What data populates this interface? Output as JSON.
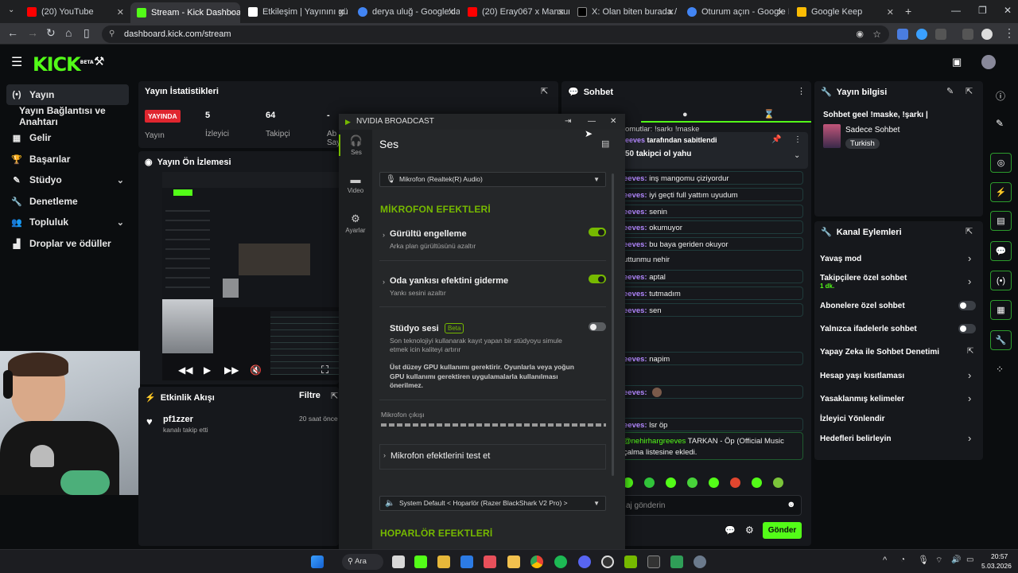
{
  "browser": {
    "tabs": [
      {
        "title": "(20) YouTube",
        "color": "#ff0000"
      },
      {
        "title": "Stream - Kick Dashboard",
        "color": "#53fc18"
      },
      {
        "title": "Etkileşim | Yayınını gü",
        "color": "#ffffff"
      },
      {
        "title": "derya uluğ - Google'da A",
        "color": "#4285f4"
      },
      {
        "title": "(20) Eray067 x Mansur - (",
        "color": "#ff0000"
      },
      {
        "title": "X: Olan biten burada / X",
        "color": "#000000"
      },
      {
        "title": "Oturum açın - Google He",
        "color": "#4285f4"
      },
      {
        "title": "Google Keep",
        "color": "#fbbc04"
      }
    ],
    "url": "dashboard.kick.com/stream"
  },
  "sidebar": {
    "items": [
      {
        "label": "Yayın",
        "icon": "(•)"
      },
      {
        "label": "Yayın Bağlantısı ve Anahtarı",
        "icon": ""
      },
      {
        "label": "Gelir",
        "icon": "▦"
      },
      {
        "label": "Başarılar",
        "icon": "🏆"
      },
      {
        "label": "Stüdyo",
        "icon": "✎"
      },
      {
        "label": "Denetleme",
        "icon": "🔧"
      },
      {
        "label": "Topluluk",
        "icon": "👥"
      },
      {
        "label": "Droplar ve ödüller",
        "icon": "▟"
      }
    ]
  },
  "stats": {
    "title": "Yayın İstatistikleri",
    "live_badge": "YAYINDA",
    "live_label": "Yayın",
    "viewers_value": "5",
    "viewers_label": "İzleyici",
    "followers_value": "64",
    "followers_label": "Takipçi",
    "col4_value": "-",
    "col4_label": "Ab",
    "col4_label2": "Say"
  },
  "preview": {
    "title": "Yayın Ön İzlemesi"
  },
  "activity": {
    "title": "Etkinlik Akışı",
    "filter": "Filtre",
    "user": "pf1zzer",
    "action": "kanalı takip etti",
    "time": "20 saat önce"
  },
  "chat": {
    "title": "Sohbet",
    "pinned_text": "tarafından sabitlendi",
    "pinned_msg": "50 takipci ol yahu",
    "top_cut": "omutlar: !sarkı !maske",
    "lines": [
      {
        "name": "eeves:",
        "text": "inş mangomu çiziyordur"
      },
      {
        "name": "eeves:",
        "text": "iyi geçti full yattım uyudum"
      },
      {
        "name": "eeves:",
        "text": "senin"
      },
      {
        "name": "eeves:",
        "text": "okumuyor"
      },
      {
        "name": "eeves:",
        "text": "bu baya geriden okuyor"
      },
      {
        "name": "",
        "text": "uttunmu nehir"
      },
      {
        "name": "eeves:",
        "text": "aptal"
      },
      {
        "name": "eeves:",
        "text": "tutmadım"
      },
      {
        "name": "eeves:",
        "text": "sen"
      },
      {
        "name": "eeves:",
        "text": "napim"
      },
      {
        "name": "eeves:",
        "text": ""
      },
      {
        "name": "eeves:",
        "text": "lsr öp"
      }
    ],
    "song_user": "@nehirhargreeves",
    "song_text": "TARKAN - Öp (Official Music",
    "song_text2": "çalma listesine ekledi.",
    "input_placeholder": "aj gönderin",
    "send": "Gönder"
  },
  "info": {
    "title": "Yayın bilgisi",
    "stream_title": "Sohbet geel !maske, !şarkı |",
    "category": "Sadece Sohbet",
    "tag": "Turkish"
  },
  "actions": {
    "title": "Kanal Eylemleri",
    "rows": [
      {
        "label": "Yavaş mod",
        "sub": ""
      },
      {
        "label": "Takipçilere özel sohbet",
        "sub": "1 dk."
      },
      {
        "label": "Abonelere özel sohbet",
        "sub": ""
      },
      {
        "label": "Yalnızca ifadelerle sohbet",
        "sub": ""
      },
      {
        "label": "Yapay Zeka ile Sohbet Denetimi",
        "sub": ""
      },
      {
        "label": "Hesap yaşı kısıtlaması",
        "sub": ""
      },
      {
        "label": "Yasaklanmış kelimeler",
        "sub": ""
      },
      {
        "label": "İzleyici Yönlendir",
        "sub": ""
      },
      {
        "label": "Hedefleri belirleyin",
        "sub": ""
      }
    ]
  },
  "nvidia": {
    "title": "NVIDIA BROADCAST",
    "tabs": [
      "Ses",
      "Video",
      "Ayarlar"
    ],
    "heading": "Ses",
    "mic_device": "Mikrofon (Realtek(R) Audio)",
    "mic_section": "MİKROFON EFEKTLERİ",
    "effect1": "Gürültü engelleme",
    "effect1_desc": "Arka plan gürültüsünü azaltır",
    "effect2": "Oda yankısı efektini giderme",
    "effect2_desc": "Yankı sesini azaltır",
    "effect3": "Stüdyo sesi",
    "effect3_badge": "Beta",
    "effect3_desc1": "Son teknolojiyi kullanarak kayıt yapan bir stüdyoyu simule",
    "effect3_desc2": "etmek icin kaliteyi artırır",
    "effect3_warn1": "Üst düzey GPU kullanımı gerektirir. Oyunlarla veya yoğun",
    "effect3_warn2": "GPU kullanımı gerektiren uygulamalarla kullanılması",
    "effect3_warn3": "önerilmez.",
    "output_label": "Mikrofon çıkışı",
    "test_label": "Mikrofon efektlerini test et",
    "speaker_device": "System Default < Hoparlör (Razer BlackShark V2 Pro) >",
    "speaker_section": "HOPARLÖR EFEKTLERİ"
  },
  "taskbar": {
    "search": "Ara",
    "time": "20:57",
    "date": "5.03.2026"
  },
  "colors": {
    "kick_green": "#53fc18",
    "nvidia_green": "#76b900",
    "live_red": "#e0262f"
  }
}
